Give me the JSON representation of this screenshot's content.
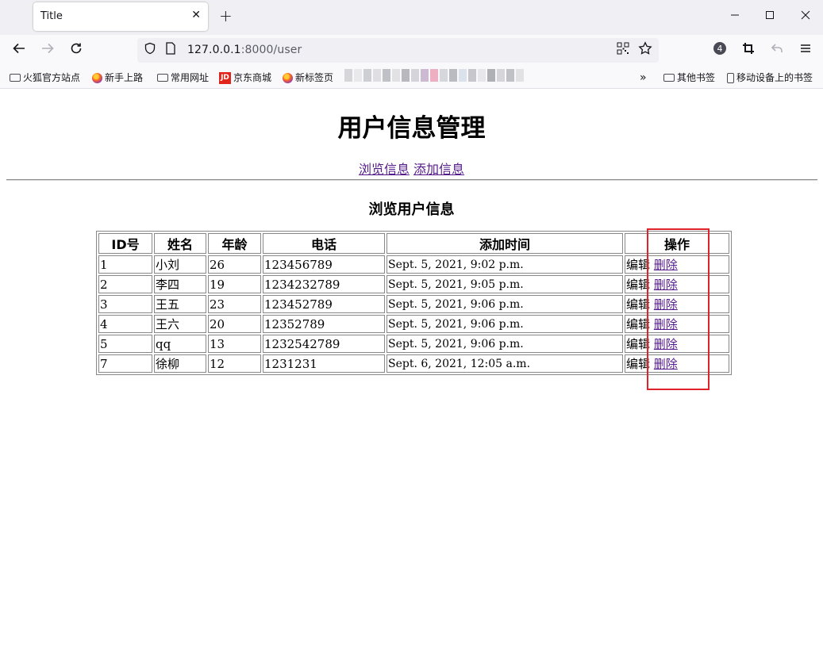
{
  "browser": {
    "tab_title": "Title",
    "tab_close": "✕",
    "new_tab": "+",
    "url_host": "127.0.0.1",
    "url_path": ":8000/user",
    "badge_count": "4"
  },
  "bookmarks": [
    {
      "label": "火狐官方站点",
      "icon": "folder-icon"
    },
    {
      "label": "新手上路",
      "icon": "firefox-icon"
    },
    {
      "label": "常用网址",
      "icon": "folder-icon"
    },
    {
      "label": "京东商城",
      "icon": "jd-icon"
    },
    {
      "label": "新标签页",
      "icon": "firefox-icon"
    }
  ],
  "bookmarks_right": [
    {
      "label": "其他书签",
      "icon": "folder-icon"
    },
    {
      "label": "移动设备上的书签",
      "icon": "mobile-icon"
    }
  ],
  "page": {
    "title": "用户信息管理",
    "nav_browse": "浏览信息",
    "nav_add": "添加信息",
    "subtitle": "浏览用户信息"
  },
  "table": {
    "headers": [
      "ID号",
      "姓名",
      "年龄",
      "电话",
      "添加时间",
      "操作"
    ],
    "edit_label": "编辑",
    "delete_label": "删除",
    "rows": [
      {
        "id": "1",
        "name": "小刘",
        "age": "26",
        "phone": "123456789",
        "time": "Sept. 5, 2021, 9:02 p.m."
      },
      {
        "id": "2",
        "name": "李四",
        "age": "19",
        "phone": "1234232789",
        "time": "Sept. 5, 2021, 9:05 p.m."
      },
      {
        "id": "3",
        "name": "王五",
        "age": "23",
        "phone": "123452789",
        "time": "Sept. 5, 2021, 9:06 p.m."
      },
      {
        "id": "4",
        "name": "王六",
        "age": "20",
        "phone": "12352789",
        "time": "Sept. 5, 2021, 9:06 p.m."
      },
      {
        "id": "5",
        "name": "qq",
        "age": "13",
        "phone": "1232542789",
        "time": "Sept. 5, 2021, 9:06 p.m."
      },
      {
        "id": "7",
        "name": "徐柳",
        "age": "12",
        "phone": "1231231",
        "time": "Sept. 6, 2021, 12:05 a.m."
      }
    ]
  },
  "colors": {
    "visited_link": "#551a8b",
    "highlight_box": "#e0232b"
  }
}
